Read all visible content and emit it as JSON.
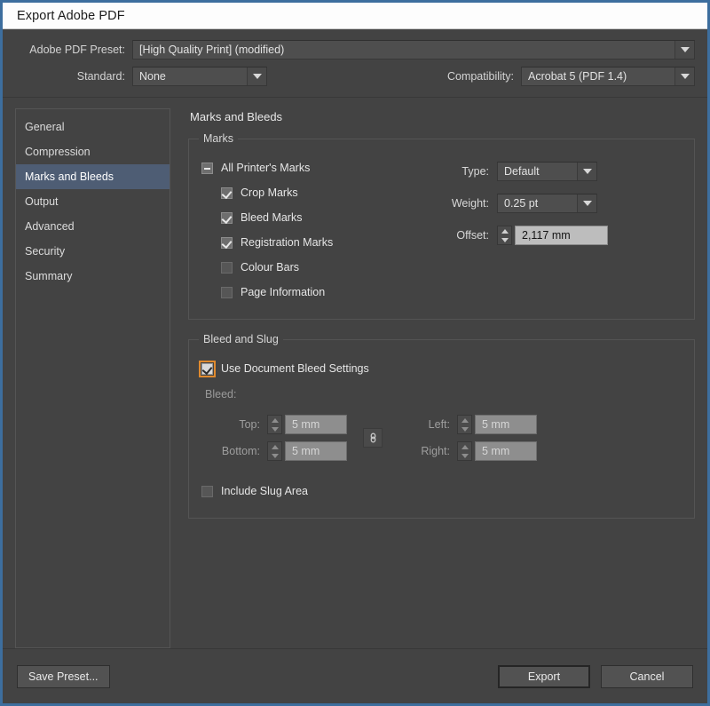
{
  "window": {
    "title": "Export Adobe PDF"
  },
  "header": {
    "preset_label": "Adobe PDF Preset:",
    "preset_value": "[High Quality Print] (modified)",
    "standard_label": "Standard:",
    "standard_value": "None",
    "compatibility_label": "Compatibility:",
    "compatibility_value": "Acrobat 5 (PDF 1.4)"
  },
  "sidebar": {
    "items": [
      {
        "label": "General",
        "selected": false
      },
      {
        "label": "Compression",
        "selected": false
      },
      {
        "label": "Marks and Bleeds",
        "selected": true
      },
      {
        "label": "Output",
        "selected": false
      },
      {
        "label": "Advanced",
        "selected": false
      },
      {
        "label": "Security",
        "selected": false
      },
      {
        "label": "Summary",
        "selected": false
      }
    ]
  },
  "pane": {
    "title": "Marks and Bleeds",
    "marks_group": {
      "legend": "Marks",
      "all_printers_marks": {
        "label": "All Printer's Marks",
        "state": "mixed"
      },
      "checkboxes": [
        {
          "label": "Crop Marks",
          "checked": true
        },
        {
          "label": "Bleed Marks",
          "checked": true
        },
        {
          "label": "Registration Marks",
          "checked": true
        },
        {
          "label": "Colour Bars",
          "checked": false
        },
        {
          "label": "Page Information",
          "checked": false
        }
      ],
      "type_label": "Type:",
      "type_value": "Default",
      "weight_label": "Weight:",
      "weight_value": "0.25 pt",
      "offset_label": "Offset:",
      "offset_value": "2,117 mm"
    },
    "bleed_group": {
      "legend": "Bleed and Slug",
      "use_document_bleed": {
        "label": "Use Document Bleed Settings",
        "checked": true,
        "focused": true
      },
      "bleed_label": "Bleed:",
      "fields": {
        "top_label": "Top:",
        "top_value": "5 mm",
        "bottom_label": "Bottom:",
        "bottom_value": "5 mm",
        "left_label": "Left:",
        "left_value": "5 mm",
        "right_label": "Right:",
        "right_value": "5 mm"
      },
      "chain_icon": "link-icon",
      "include_slug": {
        "label": "Include Slug Area",
        "checked": false
      }
    }
  },
  "footer": {
    "save_preset_label": "Save Preset...",
    "export_label": "Export",
    "cancel_label": "Cancel"
  },
  "colors": {
    "dialog_bg": "#434343",
    "window_border": "#3d6e9e",
    "titlebar_bg": "#fdfdfd",
    "selection_bg": "#4e5d74",
    "focus_ring": "#e08a2e",
    "active_input_bg": "#bdbdbd"
  }
}
